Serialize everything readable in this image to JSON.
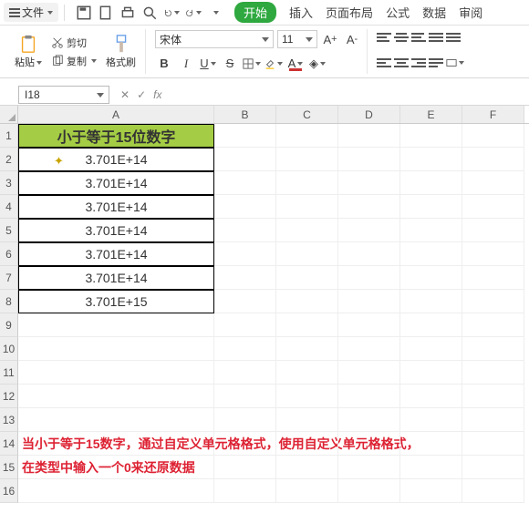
{
  "menubar": {
    "file": "文件",
    "tabs": {
      "start": "开始",
      "insert": "插入",
      "pageLayout": "页面布局",
      "formula": "公式",
      "data": "数据",
      "review": "审阅"
    }
  },
  "qat": {
    "save": "保存",
    "print": "打印",
    "preview": "预览",
    "undo": "撤销",
    "redo": "重做"
  },
  "clipboard": {
    "paste": "粘贴",
    "cut": "剪切",
    "copy": "复制",
    "format": "格式刷"
  },
  "font": {
    "family": "宋体",
    "size": "11",
    "bold": "B",
    "italic": "I",
    "underline": "U",
    "strike": "S",
    "sup": "A"
  },
  "nameBox": "I18",
  "fx": "fx",
  "cols": [
    "A",
    "B",
    "C",
    "D",
    "E",
    "F"
  ],
  "rows": [
    "1",
    "2",
    "3",
    "4",
    "5",
    "6",
    "7",
    "8",
    "9",
    "10",
    "11",
    "12",
    "13",
    "14",
    "15",
    "16"
  ],
  "colA": {
    "1": "小于等于15位数字",
    "2": "3.701E+14",
    "3": "3.701E+14",
    "4": "3.701E+14",
    "5": "3.701E+14",
    "6": "3.701E+14",
    "7": "3.701E+14",
    "8": "3.701E+15"
  },
  "note14": "当小于等于15数字，通过自定义单元格格式，使用自定义单元格格式，",
  "note15": "在类型中输入一个0来还原数据"
}
